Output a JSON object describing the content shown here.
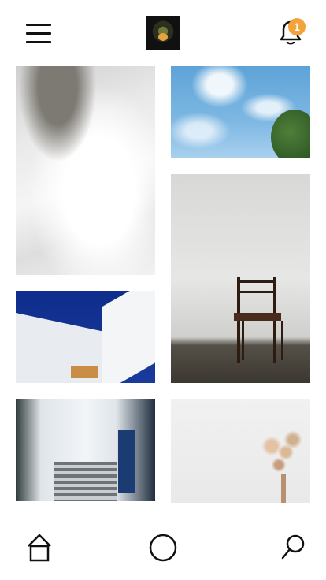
{
  "header": {
    "menu_icon": "hamburger-menu-icon",
    "logo_icon": "brand-logo",
    "notifications": {
      "icon": "bell-icon",
      "badge_count": "1",
      "badge_color": "#f2a33a"
    }
  },
  "gallery": {
    "images": [
      {
        "subject": "bed-with-glasses"
      },
      {
        "subject": "blue-sky-clouds"
      },
      {
        "subject": "wooden-chair"
      },
      {
        "subject": "white-house-blue-sky"
      },
      {
        "subject": "whitewashed-street"
      },
      {
        "subject": "dried-flowers"
      }
    ]
  },
  "bottom_nav": {
    "items": [
      {
        "icon": "home-icon"
      },
      {
        "icon": "circle-icon"
      },
      {
        "icon": "search-icon"
      }
    ]
  }
}
